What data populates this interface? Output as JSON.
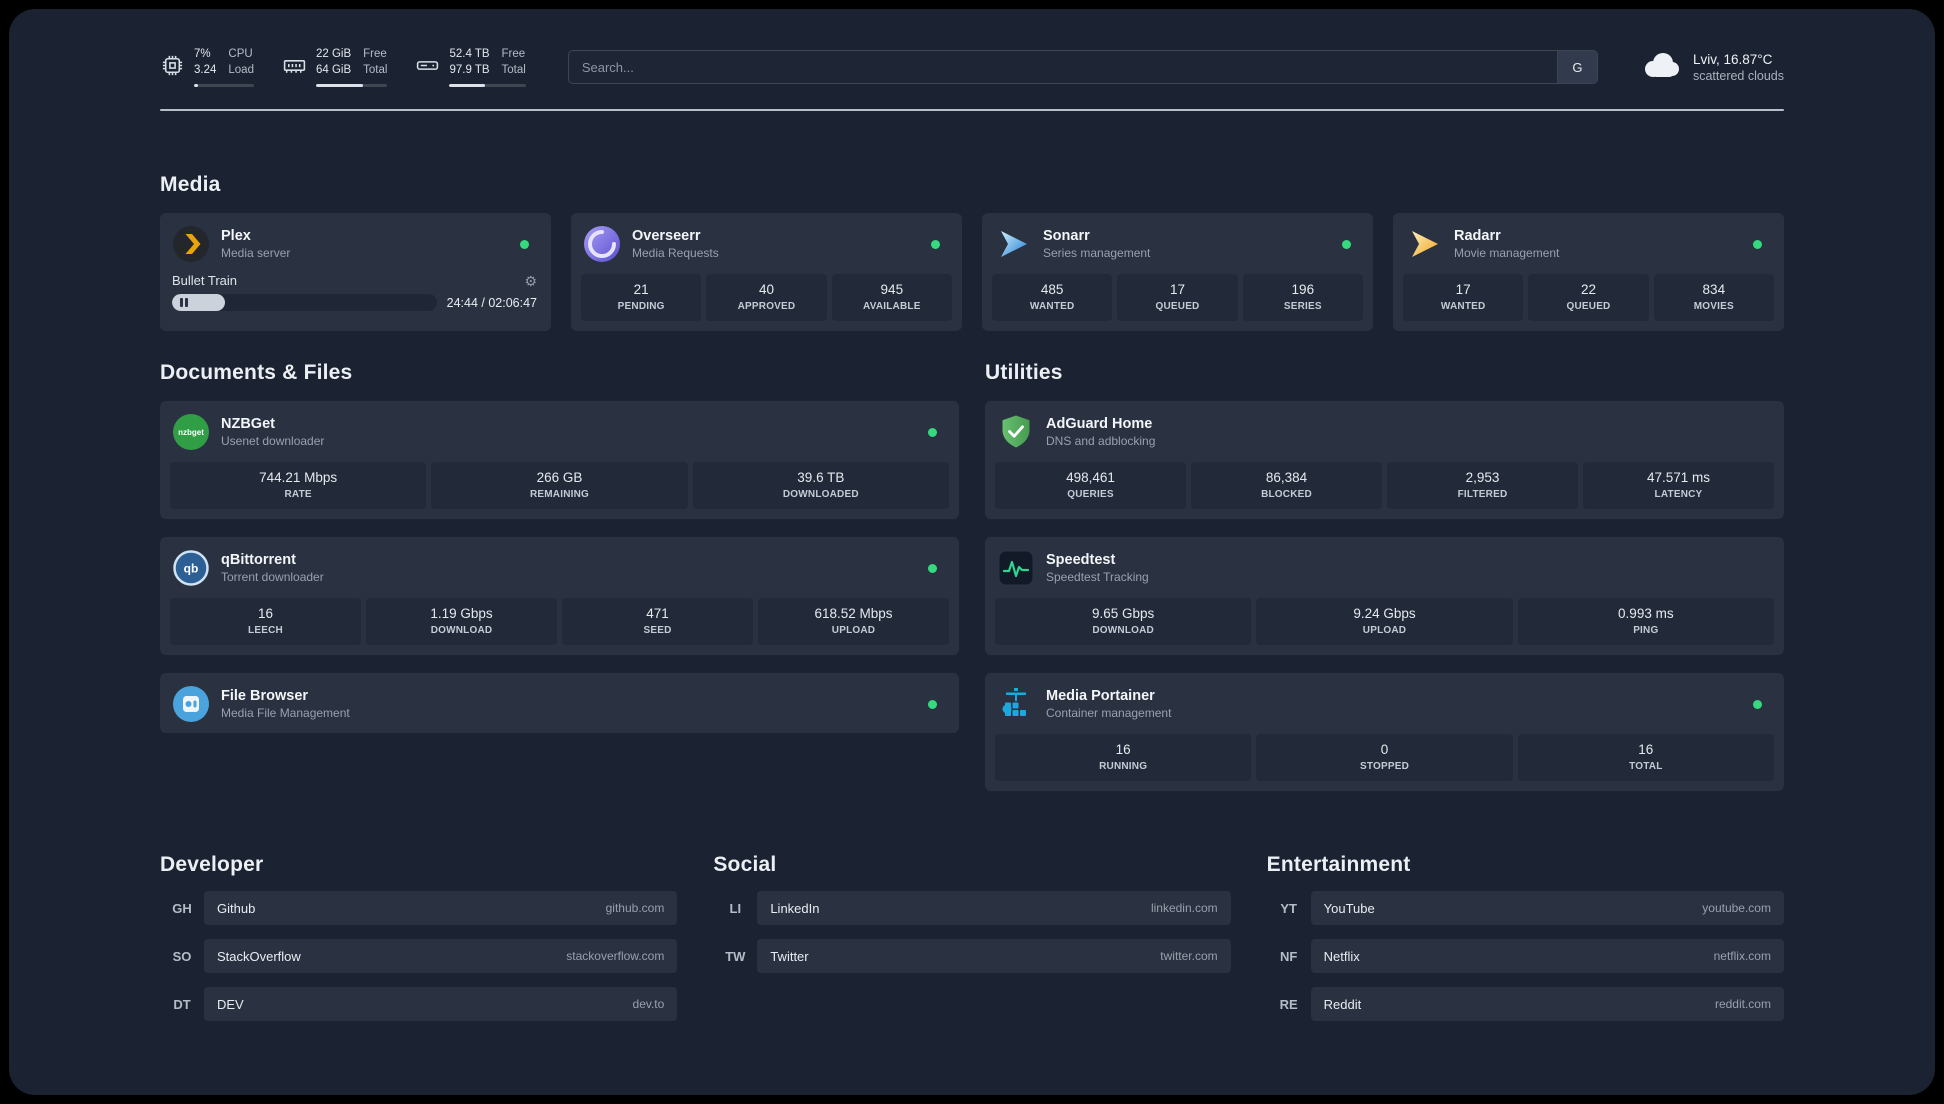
{
  "theme": {
    "background": "#1b2332",
    "card": "#2a3241",
    "tile": "#222a39",
    "status_green": "#35d97e",
    "accent_text": "#e6eaef"
  },
  "icons": {
    "gear": "⚙"
  },
  "header": {
    "cpu": {
      "value_top": "7%",
      "value_bottom": "3.24",
      "label_top": "CPU",
      "label_bottom": "Load",
      "bar_percent": 7
    },
    "memory": {
      "value_top": "22 GiB",
      "value_bottom": "64 GiB",
      "label_top": "Free",
      "label_bottom": "Total",
      "bar_percent": 66
    },
    "disk": {
      "value_top": "52.4 TB",
      "value_bottom": "97.9 TB",
      "label_top": "Free",
      "label_bottom": "Total",
      "bar_percent": 46
    },
    "search": {
      "placeholder": "Search...",
      "button_label": "G"
    },
    "weather": {
      "location": "Lviv, 16.87°C",
      "condition": "scattered clouds"
    }
  },
  "sections": {
    "media": {
      "title": "Media",
      "plex": {
        "name": "Plex",
        "subtitle": "Media server",
        "now_playing": "Bullet Train",
        "time": "24:44 / 02:06:47",
        "progress_percent": 20
      },
      "overseerr": {
        "name": "Overseerr",
        "subtitle": "Media Requests",
        "stats": [
          {
            "value": "21",
            "label": "PENDING"
          },
          {
            "value": "40",
            "label": "APPROVED"
          },
          {
            "value": "945",
            "label": "AVAILABLE"
          }
        ]
      },
      "sonarr": {
        "name": "Sonarr",
        "subtitle": "Series management",
        "stats": [
          {
            "value": "485",
            "label": "WANTED"
          },
          {
            "value": "17",
            "label": "QUEUED"
          },
          {
            "value": "196",
            "label": "SERIES"
          }
        ]
      },
      "radarr": {
        "name": "Radarr",
        "subtitle": "Movie management",
        "stats": [
          {
            "value": "17",
            "label": "WANTED"
          },
          {
            "value": "22",
            "label": "QUEUED"
          },
          {
            "value": "834",
            "label": "MOVIES"
          }
        ]
      }
    },
    "documents": {
      "title": "Documents & Files",
      "nzbget": {
        "name": "NZBGet",
        "subtitle": "Usenet downloader",
        "icon_text": "nzbget",
        "stats": [
          {
            "value": "744.21 Mbps",
            "label": "RATE"
          },
          {
            "value": "266 GB",
            "label": "REMAINING"
          },
          {
            "value": "39.6 TB",
            "label": "DOWNLOADED"
          }
        ]
      },
      "qbittorrent": {
        "name": "qBittorrent",
        "subtitle": "Torrent downloader",
        "icon_text": "qb",
        "stats": [
          {
            "value": "16",
            "label": "LEECH"
          },
          {
            "value": "1.19 Gbps",
            "label": "DOWNLOAD"
          },
          {
            "value": "471",
            "label": "SEED"
          },
          {
            "value": "618.52 Mbps",
            "label": "UPLOAD"
          }
        ]
      },
      "filebrowser": {
        "name": "File Browser",
        "subtitle": "Media File Management"
      }
    },
    "utilities": {
      "title": "Utilities",
      "adguard": {
        "name": "AdGuard Home",
        "subtitle": "DNS and adblocking",
        "stats": [
          {
            "value": "498,461",
            "label": "QUERIES"
          },
          {
            "value": "86,384",
            "label": "BLOCKED"
          },
          {
            "value": "2,953",
            "label": "FILTERED"
          },
          {
            "value": "47.571 ms",
            "label": "LATENCY"
          }
        ]
      },
      "speedtest": {
        "name": "Speedtest",
        "subtitle": "Speedtest Tracking",
        "stats": [
          {
            "value": "9.65 Gbps",
            "label": "DOWNLOAD"
          },
          {
            "value": "9.24 Gbps",
            "label": "UPLOAD"
          },
          {
            "value": "0.993 ms",
            "label": "PING"
          }
        ]
      },
      "portainer": {
        "name": "Media Portainer",
        "subtitle": "Container management",
        "stats": [
          {
            "value": "16",
            "label": "RUNNING"
          },
          {
            "value": "0",
            "label": "STOPPED"
          },
          {
            "value": "16",
            "label": "TOTAL"
          }
        ]
      }
    }
  },
  "bookmarks": {
    "developer": {
      "title": "Developer",
      "items": [
        {
          "abbr": "GH",
          "name": "Github",
          "domain": "github.com"
        },
        {
          "abbr": "SO",
          "name": "StackOverflow",
          "domain": "stackoverflow.com"
        },
        {
          "abbr": "DT",
          "name": "DEV",
          "domain": "dev.to"
        }
      ]
    },
    "social": {
      "title": "Social",
      "items": [
        {
          "abbr": "LI",
          "name": "LinkedIn",
          "domain": "linkedin.com"
        },
        {
          "abbr": "TW",
          "name": "Twitter",
          "domain": "twitter.com"
        }
      ]
    },
    "entertainment": {
      "title": "Entertainment",
      "items": [
        {
          "abbr": "YT",
          "name": "YouTube",
          "domain": "youtube.com"
        },
        {
          "abbr": "NF",
          "name": "Netflix",
          "domain": "netflix.com"
        },
        {
          "abbr": "RE",
          "name": "Reddit",
          "domain": "reddit.com"
        }
      ]
    }
  }
}
